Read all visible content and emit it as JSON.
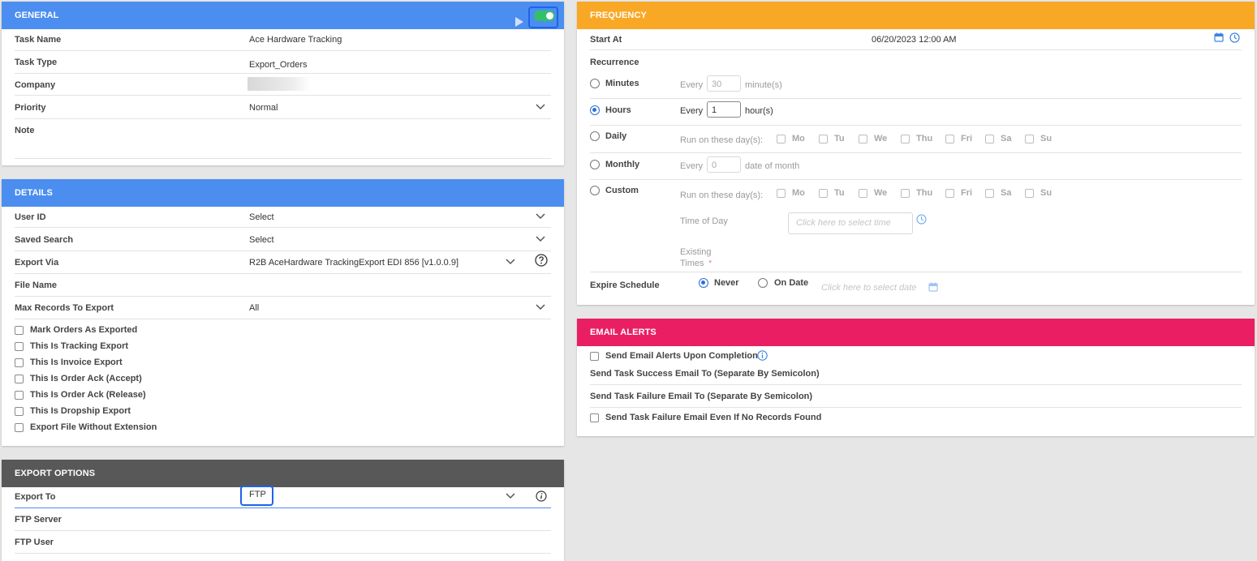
{
  "colors": {
    "general": "#4b8ef0",
    "details": "#4b8ef0",
    "frequency": "#f9a826",
    "email": "#ea1f63",
    "export": "#585858",
    "toggle": "#33c06a"
  },
  "general": {
    "title": "GENERAL",
    "task_name_label": "Task Name",
    "task_name": "Ace Hardware Tracking",
    "task_type_label": "Task Type",
    "task_type": "Export_Orders",
    "company_label": "Company",
    "priority_label": "Priority",
    "priority": "Normal",
    "note_label": "Note",
    "play_icon": "play-icon",
    "toggle_state": "on"
  },
  "details": {
    "title": "DETAILS",
    "user_id_label": "User ID",
    "user_id": "Select",
    "saved_search_label": "Saved Search",
    "saved_search": "Select",
    "export_via_label": "Export Via",
    "export_via": "R2B AceHardware TrackingExport EDI 856 [v1.0.0.9]",
    "file_name_label": "File Name",
    "max_records_label": "Max Records To Export",
    "max_records": "All",
    "checkboxes": [
      "Mark Orders As Exported",
      "This Is Tracking Export",
      "This Is Invoice Export",
      "This Is Order Ack (Accept)",
      "This Is Order Ack (Release)",
      "This Is Dropship Export",
      "Export File Without Extension"
    ]
  },
  "export": {
    "title": "EXPORT OPTIONS",
    "export_to_label": "Export To",
    "export_to": "FTP",
    "ftp_server_label": "FTP Server",
    "ftp_user_label": "FTP User"
  },
  "frequency": {
    "title": "FREQUENCY",
    "start_at_label": "Start At",
    "start_at": "06/20/2023 12:00 AM",
    "recurrence_label": "Recurrence",
    "minutes_label": "Minutes",
    "hours_label": "Hours",
    "daily_label": "Daily",
    "monthly_label": "Monthly",
    "custom_label": "Custom",
    "every": "Every",
    "minutes_value": "30",
    "minutes_unit": "minute(s)",
    "hours_value": "1",
    "hours_unit": "hour(s)",
    "monthly_value": "0",
    "monthly_unit": "date of month",
    "run_on_days": "Run on these day(s):",
    "days": [
      "Mo",
      "Tu",
      "We",
      "Thu",
      "Fri",
      "Sa",
      "Su"
    ],
    "time_of_day_label": "Time of Day",
    "time_placeholder": "Click here to select time",
    "existing_times_label": "Existing",
    "existing_times_label2": "Times",
    "required_mark": "*",
    "expire_label": "Expire Schedule",
    "never_label": "Never",
    "on_date_label": "On Date",
    "date_placeholder": "Click here to select date",
    "selected": "Hours",
    "expire_selected": "Never"
  },
  "email": {
    "title": "EMAIL ALERTS",
    "send_alerts": "Send Email Alerts Upon Completion",
    "success_label": "Send Task Success Email To (Separate By Semicolon)",
    "failure_label": "Send Task Failure Email To (Separate By Semicolon)",
    "failure_no_records": "Send Task Failure Email Even If No Records Found"
  }
}
